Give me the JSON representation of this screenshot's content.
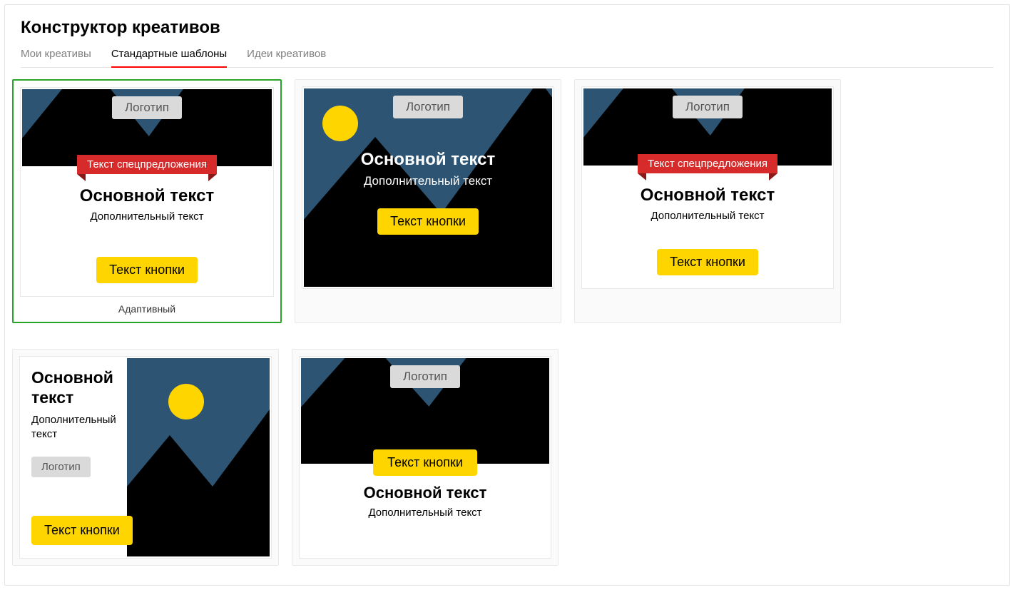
{
  "header": {
    "title": "Конструктор креативов"
  },
  "tabs": {
    "my": "Мои креативы",
    "standard": "Стандартные шаблоны",
    "ideas": "Идеи креативов"
  },
  "common": {
    "logo": "Логотип",
    "special": "Текст спецпредложения",
    "main": "Основной текст",
    "sub": "Дополнительный текст",
    "btn": "Текст кнопки"
  },
  "captions": {
    "adaptive": "Адаптивный"
  }
}
